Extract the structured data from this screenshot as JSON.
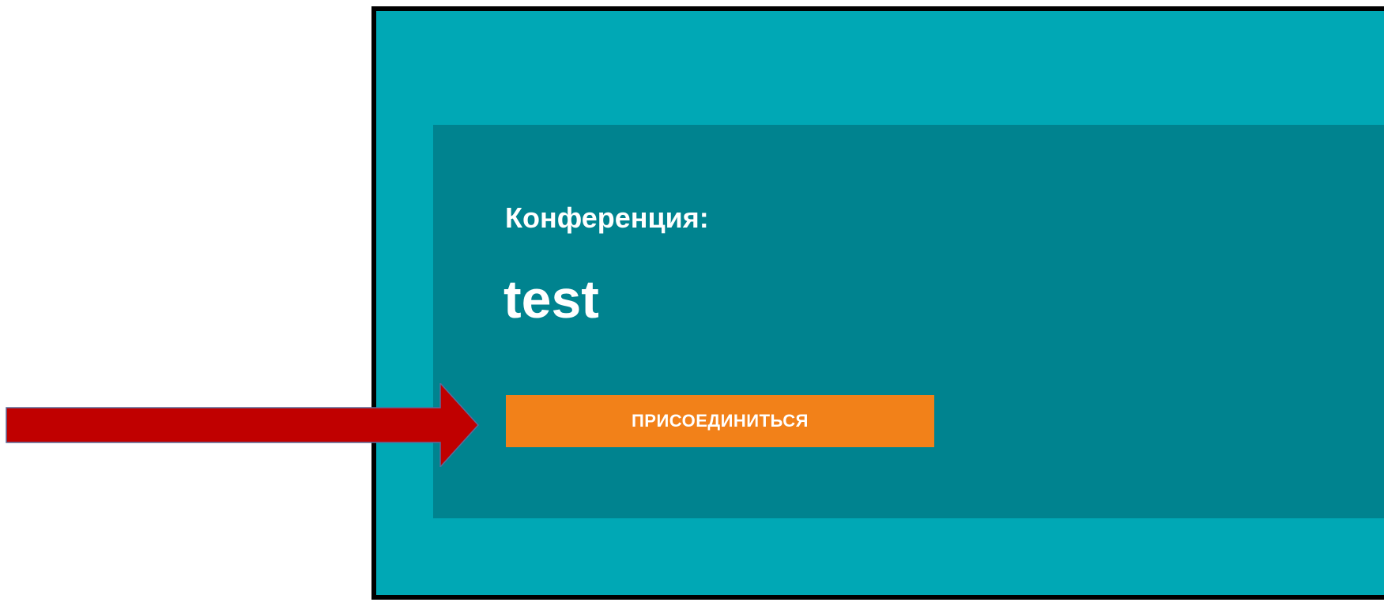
{
  "conference": {
    "label": "Конференция:",
    "name": "test",
    "join_button": "ПРИСОЕДИНИТЬСЯ"
  },
  "colors": {
    "frame_bg": "#00A8B5",
    "card_bg": "#00838F",
    "button_bg": "#F28119",
    "arrow": "#C00000",
    "border": "#000000"
  },
  "icons": {
    "pointer": "arrow-right-icon"
  }
}
